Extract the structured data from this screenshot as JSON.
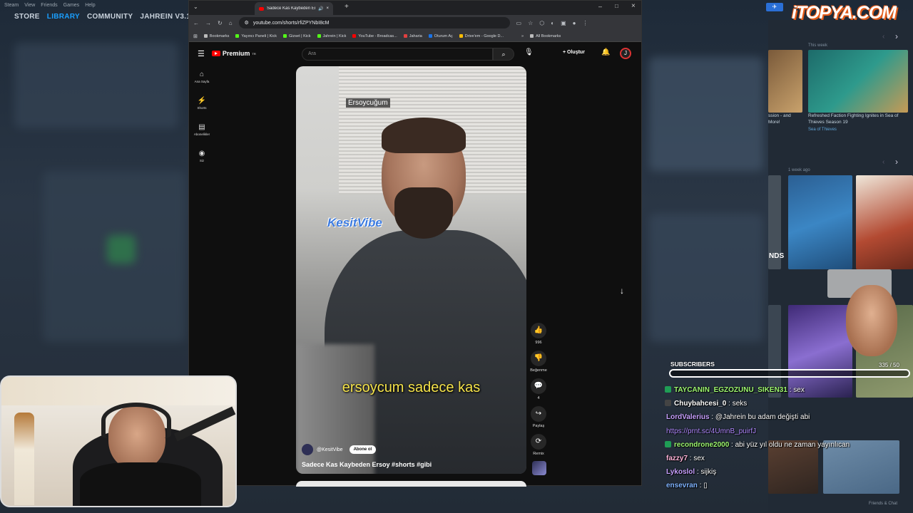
{
  "steam": {
    "menu": [
      "Steam",
      "View",
      "Friends",
      "Games",
      "Help"
    ],
    "nav": [
      "STORE",
      "LIBRARY",
      "COMMUNITY",
      "JAHREIN V3.1"
    ],
    "friends_chat": "Friends & Chat",
    "cards": {
      "this_week": "This week",
      "card1_title": "Refreshed Faction Fighting Ignites in Sea of Thieves Season 19",
      "card1_game": "Sea of Thieves",
      "partial_title": "ssion - and More!",
      "week_ago": "1 week ago",
      "partial_text": "NDS"
    }
  },
  "sponsor_logo": "iTOPYA.COM",
  "browser": {
    "tab_title": "Sadece Kas Kaybeden Ersoy",
    "url": "youtube.com/shorts/rfiZPYNbI8cM",
    "bookmarks": [
      {
        "label": "Bookmarks",
        "color": "#bbbbbb"
      },
      {
        "label": "Yayıncı Paneli | Kick",
        "color": "#53fc18"
      },
      {
        "label": "Gizset | Kick",
        "color": "#53fc18"
      },
      {
        "label": "Jahrein | Kick",
        "color": "#53fc18"
      },
      {
        "label": "YouTube - Broadcas...",
        "color": "#ff0000"
      },
      {
        "label": "Jaharia",
        "color": "#e04040"
      },
      {
        "label": "Oturum Aç",
        "color": "#1a73e8"
      },
      {
        "label": "Drive'em - Google D...",
        "color": "#fbbc04"
      }
    ],
    "all_bookmarks": "All Bookmarks"
  },
  "youtube": {
    "brand": "Premium",
    "brand_sup": "TR",
    "search_placeholder": "Ara",
    "create_label": "Oluştur",
    "sidebar": [
      {
        "icon": "⌂",
        "label": "Ana Sayfa"
      },
      {
        "icon": "⚡",
        "label": "Shorts"
      },
      {
        "icon": "▤",
        "label": "Abonelikler"
      },
      {
        "icon": "◉",
        "label": "Siz"
      }
    ],
    "short": {
      "caption_top": "Ersoycuğum",
      "watermark": "KesitVibe",
      "subtitle": "ersoycum sadece kas",
      "channel": "@KesitVibe",
      "subscribe": "Abone ol",
      "title": "Sadece Kas Kaybeden Ersoy #shorts #gibi"
    },
    "actions": [
      {
        "icon": "👍",
        "label": "996"
      },
      {
        "icon": "👎",
        "label": "Beğenme"
      },
      {
        "icon": "💬",
        "label": "4"
      },
      {
        "icon": "↪",
        "label": "Paylaş"
      },
      {
        "icon": "⟳",
        "label": "Remix"
      }
    ]
  },
  "overlay": {
    "subs_label": "SUBSCRIBERS",
    "subs_count": "335 / 50",
    "chat": [
      {
        "user": "TAYCANIN_EGZOZUNU_SIKEN31",
        "color": "#9ef870",
        "badge": "#1f9d55",
        "text": " : sex"
      },
      {
        "user": "Chuybahcesi_0",
        "color": "#ffffff",
        "badge": "#444444",
        "text": " : seks"
      },
      {
        "user": "LordValerius",
        "color": "#c7a0ff",
        "badge": "",
        "text": " : @Jahrein bu adam değişti abi"
      },
      {
        "user": "",
        "color": "#b089ff",
        "badge": "",
        "text": "https://prnt.sc/4UmnB_puirfJ"
      },
      {
        "user": "recondrone2000",
        "color": "#9ef870",
        "badge": "#1f9d55",
        "text": " : abi yüz yıl oldu ne zaman yayınlıcan"
      },
      {
        "user": "fazzy7",
        "color": "#ffb3d9",
        "badge": "",
        "text": " : sex"
      },
      {
        "user": "Lykoslol",
        "color": "#c7a0ff",
        "badge": "",
        "text": " : sijkiş"
      },
      {
        "user": "ensevran",
        "color": "#7fb3ff",
        "badge": "",
        "text": " : ▯"
      }
    ]
  }
}
